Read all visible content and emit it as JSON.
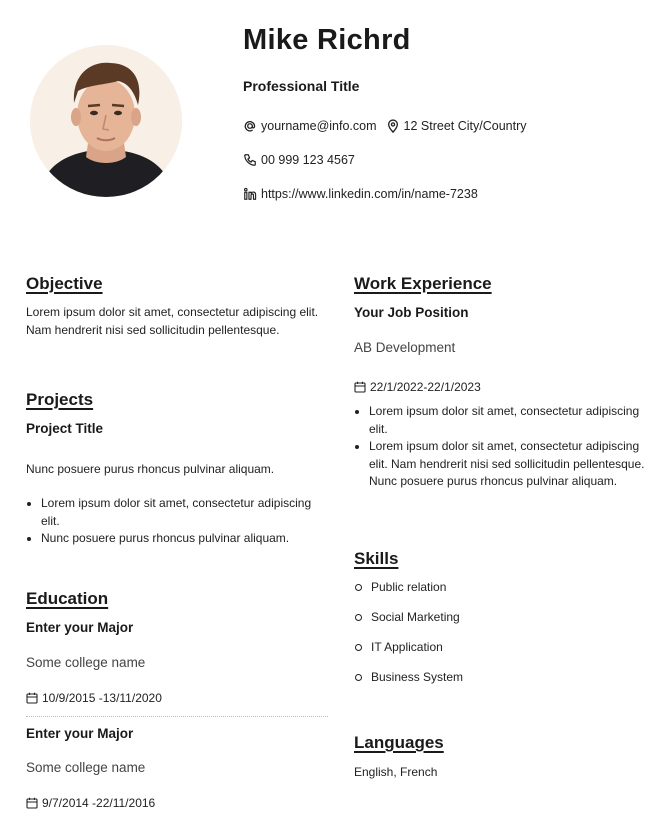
{
  "header": {
    "name": "Mike Richrd",
    "title": "Professional Title",
    "email": "yourname@info.com",
    "address": "12 Street City/Country",
    "phone": "00 999 123 4567",
    "linkedin": "https://www.linkedin.com/in/name-7238"
  },
  "objective": {
    "heading": "Objective",
    "text": "Lorem ipsum dolor sit amet, consectetur adipiscing elit. Nam hendrerit nisi sed sollicitudin pellentesque."
  },
  "projects": {
    "heading": "Projects",
    "title": "Project Title",
    "description": "Nunc posuere purus rhoncus pulvinar aliquam.",
    "bullets": [
      "Lorem ipsum dolor sit amet, consectetur adipiscing elit.",
      "Nunc posuere purus rhoncus pulvinar aliquam."
    ]
  },
  "education": {
    "heading": "Education",
    "entries": [
      {
        "major": "Enter your Major",
        "school": "Some college name",
        "dates": "10/9/2015 -13/11/2020"
      },
      {
        "major": "Enter your Major",
        "school": "Some college name",
        "dates": "9/7/2014 -22/11/2016"
      }
    ]
  },
  "work": {
    "heading": "Work Experience",
    "position": "Your Job Position",
    "company": "AB Development",
    "dates": "22/1/2022-22/1/2023",
    "bullets": [
      "Lorem ipsum dolor sit amet, consectetur adipiscing elit.",
      "Lorem ipsum dolor sit amet, consectetur adipiscing elit. Nam hendrerit nisi sed sollicitudin pellentesque. Nunc posuere purus rhoncus pulvinar aliquam."
    ]
  },
  "skills": {
    "heading": "Skills",
    "items": [
      "Public relation",
      "Social Marketing",
      "IT Application",
      "Business System"
    ]
  },
  "languages": {
    "heading": "Languages",
    "text": "English, French"
  }
}
